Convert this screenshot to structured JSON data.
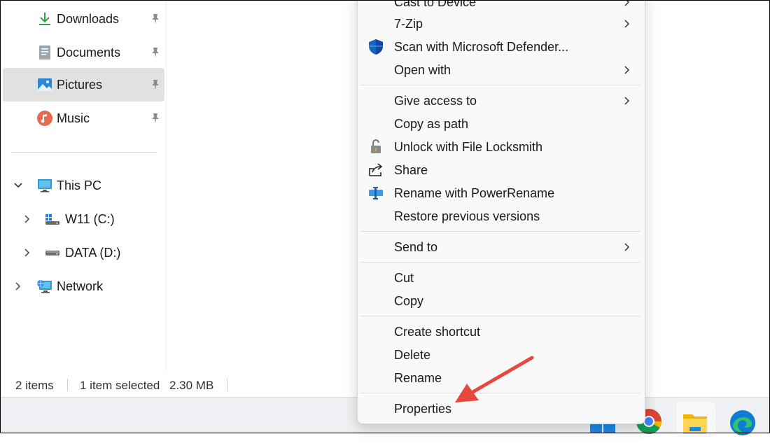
{
  "sidebar": {
    "items": [
      {
        "label": "Downloads",
        "icon": "download-icon",
        "pinned": true
      },
      {
        "label": "Documents",
        "icon": "documents-icon",
        "pinned": true
      },
      {
        "label": "Pictures",
        "icon": "pictures-icon",
        "pinned": true,
        "selected": true
      },
      {
        "label": "Music",
        "icon": "music-icon",
        "pinned": true
      }
    ],
    "tree": [
      {
        "label": "This PC",
        "icon": "monitor-icon",
        "expanded": true
      },
      {
        "label": "W11 (C:)",
        "icon": "windows-drive-icon",
        "expanded": false
      },
      {
        "label": "DATA (D:)",
        "icon": "drive-icon",
        "expanded": false
      },
      {
        "label": "Network",
        "icon": "network-icon",
        "expanded": false
      }
    ]
  },
  "status": {
    "items_count": "2 items",
    "selected": "1 item selected",
    "size": "2.30 MB"
  },
  "context_menu": {
    "items": [
      {
        "label": "Cast to Device",
        "submenu": true
      },
      {
        "label": "7-Zip",
        "submenu": true
      },
      {
        "label": "Scan with Microsoft Defender...",
        "icon": "defender-shield-icon"
      },
      {
        "label": "Open with",
        "submenu": true
      },
      {
        "label": "Give access to",
        "submenu": true
      },
      {
        "label": "Copy as path"
      },
      {
        "label": "Unlock with File Locksmith",
        "icon": "lock-icon"
      },
      {
        "label": "Share",
        "icon": "share-icon"
      },
      {
        "label": "Rename with PowerRename",
        "icon": "powerrename-icon"
      },
      {
        "label": "Restore previous versions"
      },
      {
        "label": "Send to",
        "submenu": true
      },
      {
        "label": "Cut"
      },
      {
        "label": "Copy"
      },
      {
        "label": "Create shortcut"
      },
      {
        "label": "Delete"
      },
      {
        "label": "Rename"
      },
      {
        "label": "Properties",
        "highlighted_by_arrow": true
      }
    ]
  },
  "taskbar": {
    "apps": [
      "windows-start-icon",
      "chrome-icon",
      "file-explorer-icon",
      "edge-icon"
    ]
  },
  "colors": {
    "annotation_arrow": "#e8473e",
    "selected_bg": "#e1e1e1",
    "menu_bg": "#f9f9f9",
    "defender_blue": "#1565c0"
  }
}
